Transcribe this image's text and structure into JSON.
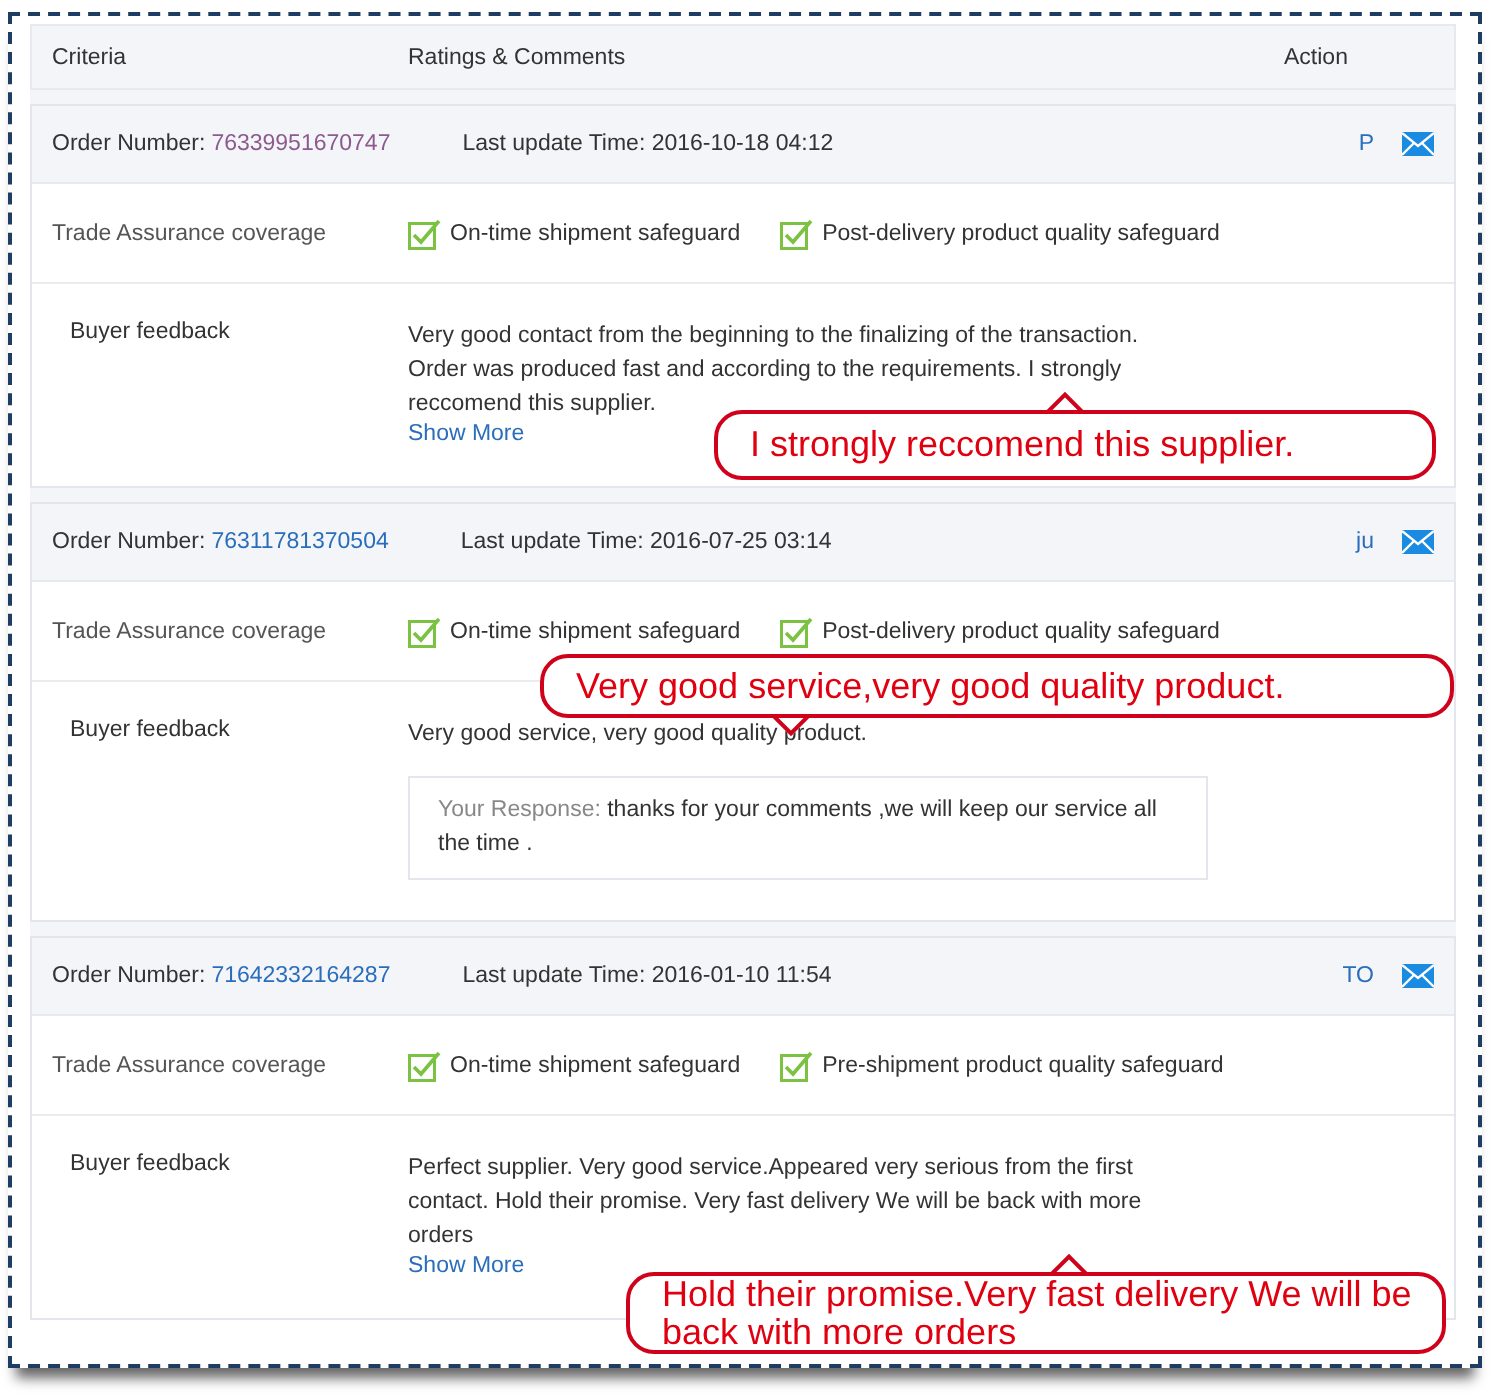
{
  "header": {
    "columns": [
      "Criteria",
      "Ratings & Comments",
      "Action"
    ]
  },
  "orders": [
    {
      "order_label": "Order Number:",
      "order_number": "76339951670747",
      "visited": true,
      "update": "Last update Time: 2016-10-18 04:12",
      "action": "P",
      "coverage_label": "Trade Assurance coverage",
      "safeguards": [
        {
          "label": "On-time shipment safeguard",
          "checked": true
        },
        {
          "label": "Post-delivery product quality safeguard",
          "checked": true
        }
      ],
      "feedback_label": "Buyer feedback",
      "feedback": "Very good contact from the beginning to the finalizing of the transaction. Order was produced fast and according to the requirements. I strongly reccomend this supplier.",
      "show_more": "Show More",
      "callout": {
        "text": "I strongly reccomend this supplier."
      }
    },
    {
      "order_label": "Order Number:",
      "order_number": "76311781370504",
      "visited": false,
      "update": "Last update Time: 2016-07-25 03:14",
      "action": "ju",
      "coverage_label": "Trade Assurance coverage",
      "safeguards": [
        {
          "label": "On-time shipment safeguard",
          "checked": true
        },
        {
          "label": "Post-delivery product quality safeguard",
          "checked": true
        }
      ],
      "feedback_label": "Buyer feedback",
      "feedback": "Very good service, very good quality product.",
      "response": {
        "label": "Your Response:",
        "text": "thanks for your comments ,we will keep our service all the time ."
      },
      "callout": {
        "text": "Very good service,very good quality product."
      }
    },
    {
      "order_label": "Order Number:",
      "order_number": "71642332164287",
      "visited": false,
      "update": "Last update Time: 2016-01-10 11:54",
      "action": "TO",
      "coverage_label": "Trade Assurance coverage",
      "safeguards": [
        {
          "label": "On-time shipment safeguard",
          "checked": true
        },
        {
          "label": "Pre-shipment product quality safeguard",
          "checked": true
        }
      ],
      "feedback_label": "Buyer feedback",
      "feedback": "Perfect supplier. Very good service.Appeared very serious from the first contact. Hold their promise. Very fast delivery We will be back with more orders",
      "show_more": "Show More",
      "callout": {
        "text": "Hold their promise.Very fast delivery We will be back with more orders"
      }
    }
  ]
}
